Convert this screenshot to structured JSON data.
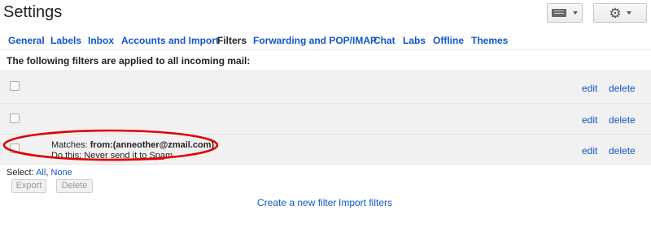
{
  "header": {
    "title": "Settings"
  },
  "tabs": [
    {
      "label": "General",
      "active": false
    },
    {
      "label": "Labels",
      "active": false
    },
    {
      "label": "Inbox",
      "active": false
    },
    {
      "label": "Accounts and Import",
      "active": false
    },
    {
      "label": "Filters",
      "active": true
    },
    {
      "label": "Forwarding and POP/IMAP",
      "active": false
    },
    {
      "label": "Chat",
      "active": false
    },
    {
      "label": "Labs",
      "active": false
    },
    {
      "label": "Offline",
      "active": false
    },
    {
      "label": "Themes",
      "active": false
    }
  ],
  "filters": {
    "intro": "The following filters are applied to all incoming mail:",
    "rows": [
      {
        "edit": "edit",
        "delete": "delete"
      },
      {
        "edit": "edit",
        "delete": "delete"
      },
      {
        "matches_label": "Matches: ",
        "matches_value": "from:(anneother@zmail.com)",
        "action": "Do this: Never send it to Spam",
        "edit": "edit",
        "delete": "delete"
      }
    ]
  },
  "select": {
    "label": "Select: ",
    "all": "All",
    "separator": ", ",
    "none": "None"
  },
  "buttons": {
    "export": "Export",
    "delete": "Delete"
  },
  "links": {
    "create": "Create a new filter",
    "import": "Import filters"
  },
  "colors": {
    "link": "#1155cc",
    "highlight_oval": "#e00000",
    "row_bg": "#f1f1f1"
  }
}
